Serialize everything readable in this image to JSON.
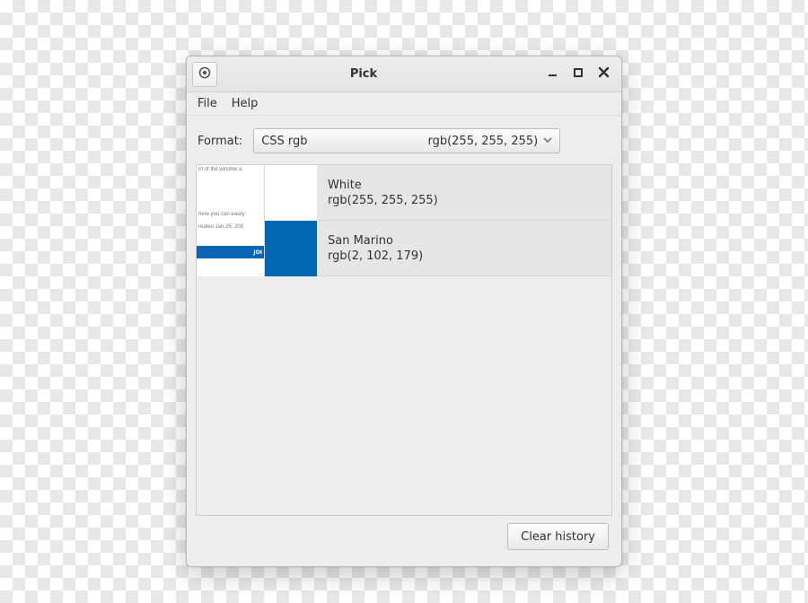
{
  "titlebar": {
    "title": "Pick"
  },
  "menubar": {
    "file": "File",
    "help": "Help"
  },
  "format": {
    "label": "Format:",
    "selected": "CSS rgb",
    "preview": "rgb(255, 255, 255)"
  },
  "history": [
    {
      "name": "White",
      "value": "rgb(255, 255, 255)",
      "swatch": "#ffffff",
      "thumb_lines": [
        "irt of the window a",
        "here you can easily"
      ]
    },
    {
      "name": "San Marino",
      "value": "rgb(2, 102, 179)",
      "swatch": "#0266b3",
      "thumb_lines": [
        "reated Jan 25, 200",
        "JOI"
      ]
    }
  ],
  "footer": {
    "clear": "Clear history"
  }
}
